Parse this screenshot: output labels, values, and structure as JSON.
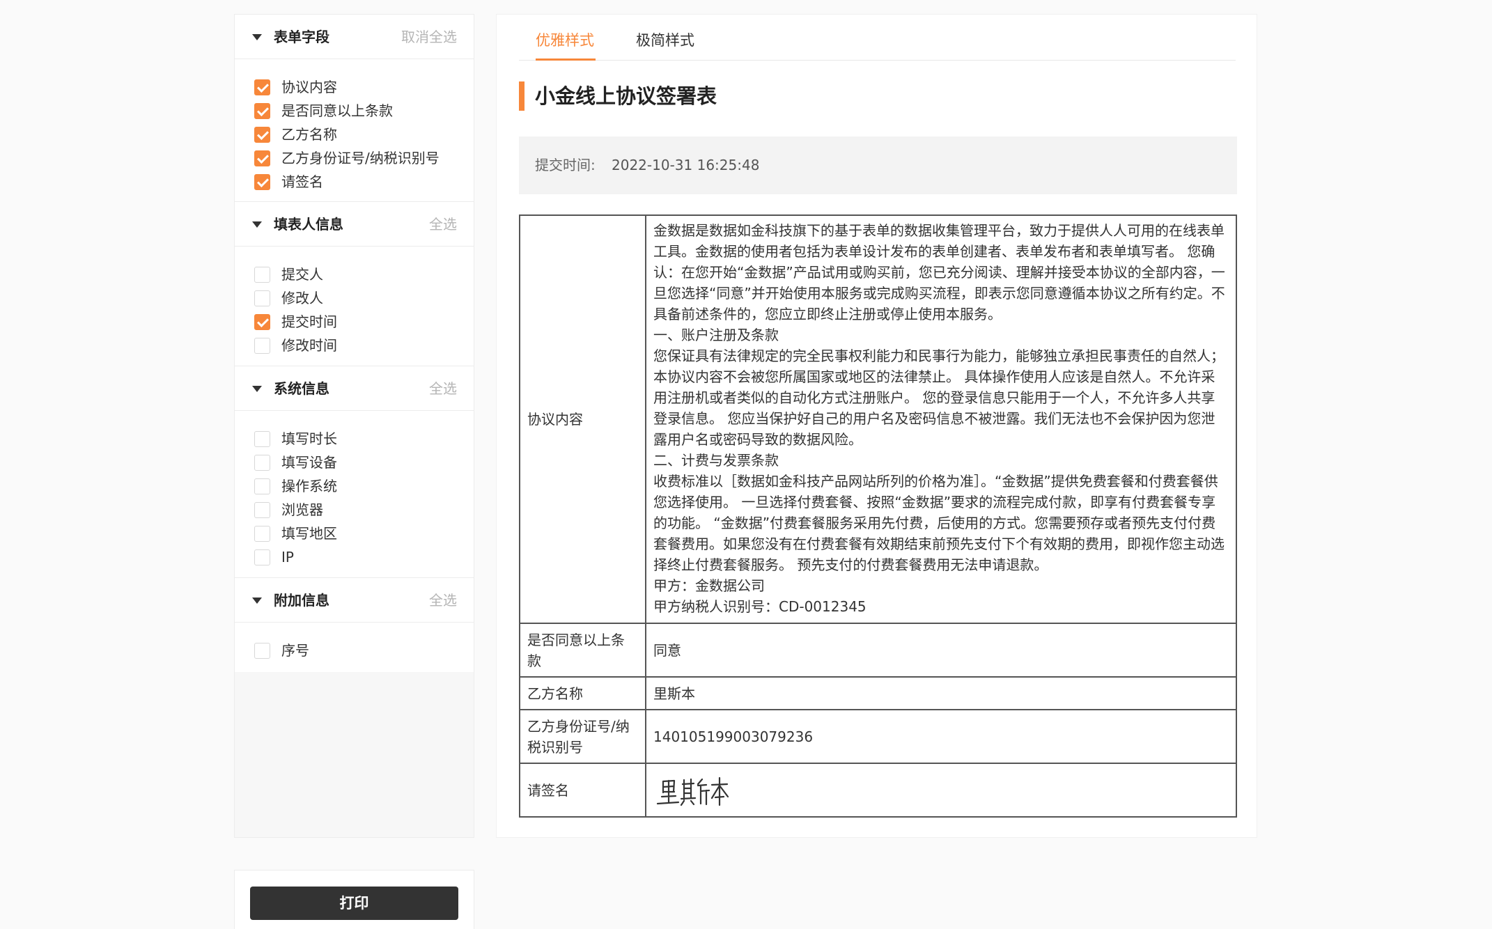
{
  "sidebar": {
    "sections": [
      {
        "title": "表单字段",
        "action": "取消全选",
        "items": [
          {
            "label": "协议内容",
            "checked": true
          },
          {
            "label": "是否同意以上条款",
            "checked": true
          },
          {
            "label": "乙方名称",
            "checked": true
          },
          {
            "label": "乙方身份证号/纳税识别号",
            "checked": true
          },
          {
            "label": "请签名",
            "checked": true
          }
        ]
      },
      {
        "title": "填表人信息",
        "action": "全选",
        "items": [
          {
            "label": "提交人",
            "checked": false
          },
          {
            "label": "修改人",
            "checked": false
          },
          {
            "label": "提交时间",
            "checked": true
          },
          {
            "label": "修改时间",
            "checked": false
          }
        ]
      },
      {
        "title": "系统信息",
        "action": "全选",
        "items": [
          {
            "label": "填写时长",
            "checked": false
          },
          {
            "label": "填写设备",
            "checked": false
          },
          {
            "label": "操作系统",
            "checked": false
          },
          {
            "label": "浏览器",
            "checked": false
          },
          {
            "label": "填写地区",
            "checked": false
          },
          {
            "label": "IP",
            "checked": false
          }
        ]
      },
      {
        "title": "附加信息",
        "action": "全选",
        "items": [
          {
            "label": "序号",
            "checked": false
          }
        ]
      }
    ]
  },
  "print_label": "打印",
  "tabs": [
    {
      "label": "优雅样式",
      "active": true
    },
    {
      "label": "极简样式",
      "active": false
    }
  ],
  "document": {
    "title": "小金线上协议签署表",
    "submit_label": "提交时间:",
    "submit_time": "2022-10-31 16:25:48"
  },
  "table": {
    "agreement": {
      "key": "协议内容",
      "paragraphs": [
        "金数据是数据如金科技旗下的基于表单的数据收集管理平台，致力于提供人人可用的在线表单工具。金数据的使用者包括为表单设计发布的表单创建者、表单发布者和表单填写者。 您确认：在您开始“金数据”产品试用或购买前，您已充分阅读、理解并接受本协议的全部内容，一旦您选择“同意”并开始使用本服务或完成购买流程，即表示您同意遵循本协议之所有约定。不具备前述条件的，您应立即终止注册或停止使用本服务。",
        "一、账户注册及条款",
        "您保证具有法律规定的完全民事权利能力和民事行为能力，能够独立承担民事责任的自然人；本协议内容不会被您所属国家或地区的法律禁止。 具体操作使用人应该是自然人。不允许采用注册机或者类似的自动化方式注册账户。 您的登录信息只能用于一个人，不允许多人共享登录信息。 您应当保护好自己的用户名及密码信息不被泄露。我们无法也不会保护因为您泄露用户名或密码导致的数据风险。",
        "二、计费与发票条款",
        "收费标准以［数据如金科技产品网站所列的价格为准］。“金数据”提供免费套餐和付费套餐供您选择使用。 一旦选择付费套餐、按照“金数据”要求的流程完成付款，即享有付费套餐专享的功能。 “金数据”付费套餐服务采用先付费，后使用的方式。您需要预存或者预先支付付费套餐费用。如果您没有在付费套餐有效期结束前预先支付下个有效期的费用，即视作您主动选择终止付费套餐服务。 预先支付的付费套餐费用无法申请退款。",
        "甲方：金数据公司",
        "甲方纳税人识别号：CD-0012345"
      ]
    },
    "agree": {
      "key": "是否同意以上条款",
      "value": "同意"
    },
    "party_b_name": {
      "key": "乙方名称",
      "value": "里斯本"
    },
    "party_b_id": {
      "key": "乙方身份证号/纳税识别号",
      "value": "140105199003079236"
    },
    "signature": {
      "key": "请签名",
      "signature_text": "里斯本"
    }
  },
  "colors": {
    "accent": "#f7873a",
    "dark_button": "#333333",
    "muted_action": "#b5b5b5"
  }
}
